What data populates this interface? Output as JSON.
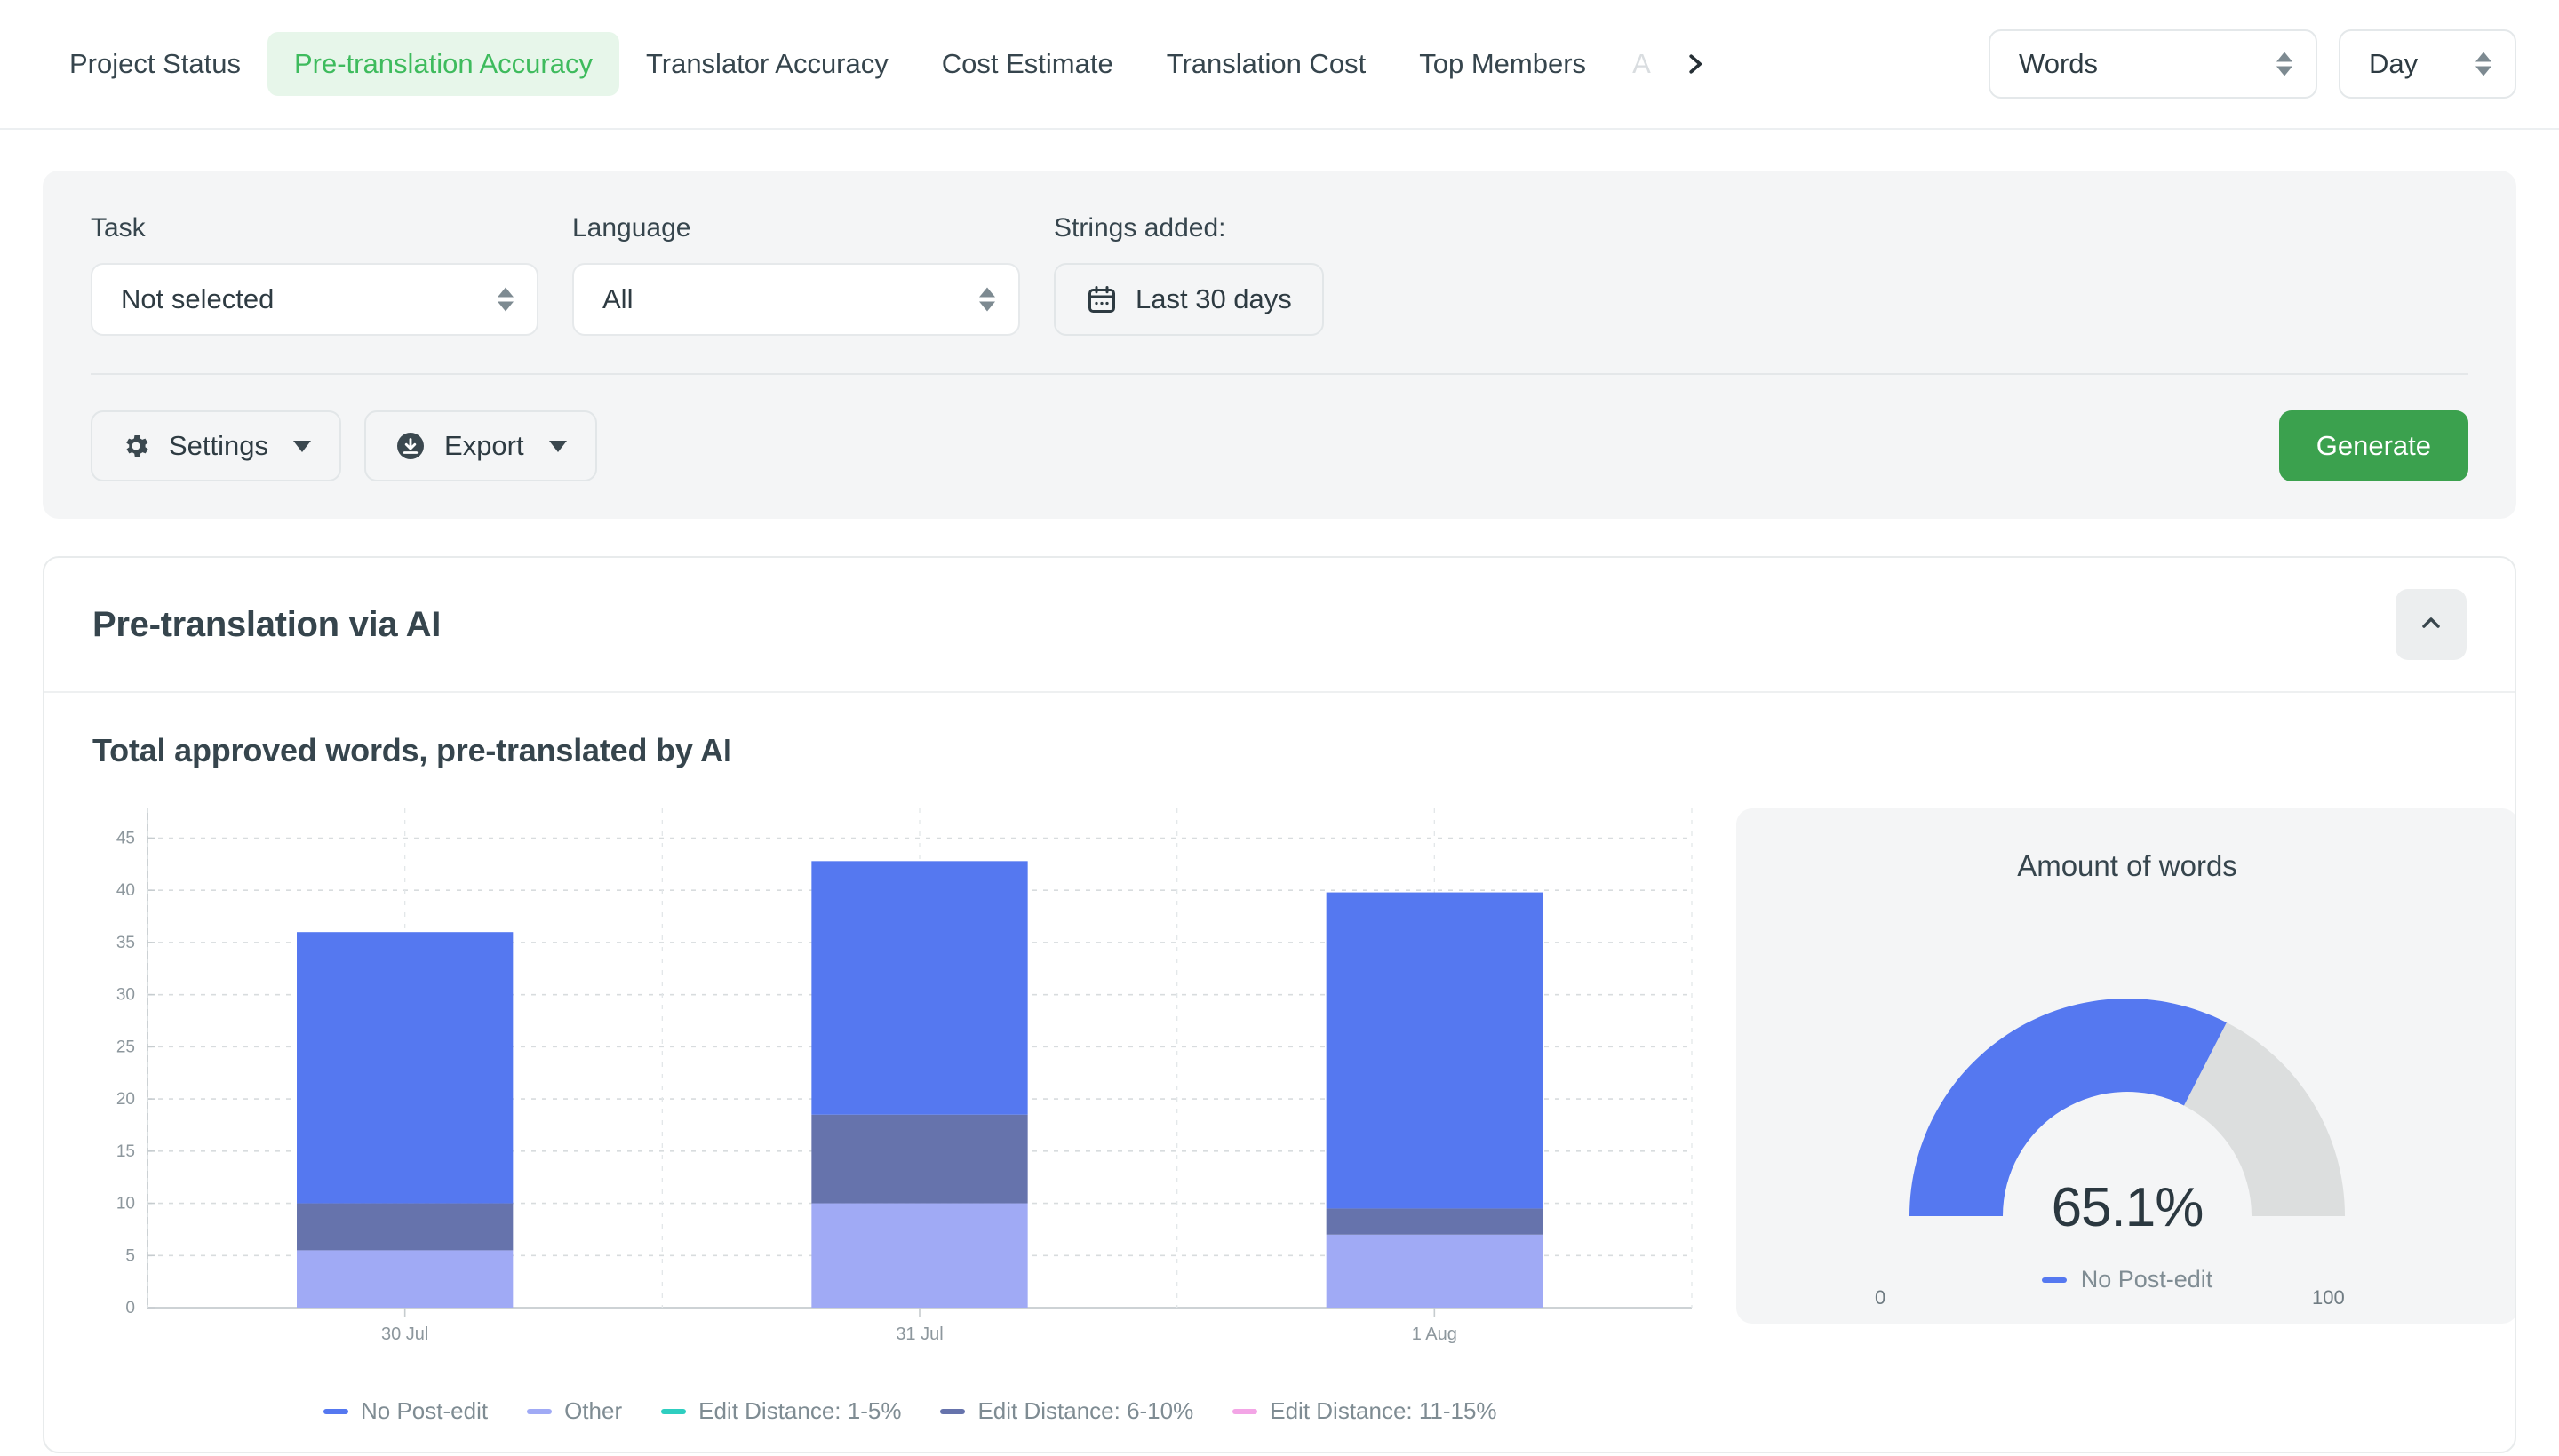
{
  "tabs": [
    {
      "label": "Project Status",
      "active": false
    },
    {
      "label": "Pre-translation Accuracy",
      "active": true
    },
    {
      "label": "Translator Accuracy",
      "active": false
    },
    {
      "label": "Cost Estimate",
      "active": false
    },
    {
      "label": "Translation Cost",
      "active": false
    },
    {
      "label": "Top Members",
      "active": false
    },
    {
      "label": "A",
      "active": false,
      "clipped": true
    }
  ],
  "tab_next_icon": "chevron-right-icon",
  "top_selects": [
    {
      "name": "unit-select",
      "value": "Words"
    },
    {
      "name": "period-select",
      "value": "Day"
    }
  ],
  "filters": {
    "task": {
      "label": "Task",
      "value": "Not selected"
    },
    "language": {
      "label": "Language",
      "value": "All"
    },
    "strings_added": {
      "label": "Strings added:",
      "value": "Last 30 days",
      "icon": "calendar-icon"
    }
  },
  "toolbar": {
    "settings_label": "Settings",
    "settings_icon": "gear-icon",
    "export_label": "Export",
    "export_icon": "download-circle-icon",
    "generate_label": "Generate"
  },
  "card": {
    "title": "Pre-translation via AI",
    "collapse_icon": "chevron-up-icon",
    "chart_title": "Total approved words, pre-translated by AI"
  },
  "colors": {
    "no_post_edit": "#5578F0",
    "other": "#A0AAF5",
    "ed_1_5": "#2ECEC0",
    "ed_6_10": "#6673AC",
    "ed_11_15": "#F3A5E6",
    "gauge_track": "#DCDEDE",
    "accent_green": "#3ba14e",
    "tab_active_text": "#3ebb5d",
    "tab_active_bg": "#e7f6ea"
  },
  "chart_data": [
    {
      "type": "bar",
      "subtype": "stacked",
      "title": "Total approved words, pre-translated by AI",
      "xlabel": "",
      "ylabel": "",
      "categories": [
        "30 Jul",
        "31 Jul",
        "1 Aug"
      ],
      "ylim": [
        0,
        47
      ],
      "yticks": [
        0,
        5,
        10,
        15,
        20,
        25,
        30,
        35,
        40,
        45
      ],
      "grid": true,
      "legend_position": "bottom",
      "series": [
        {
          "name": "Other",
          "color": "#A0AAF5",
          "values": [
            5.5,
            10.0,
            7.0
          ]
        },
        {
          "name": "Edit Distance: 6-10%",
          "color": "#6673AC",
          "values": [
            4.5,
            8.5,
            2.5
          ]
        },
        {
          "name": "No Post-edit",
          "color": "#5578F0",
          "values": [
            26.0,
            24.3,
            30.3
          ]
        },
        {
          "name": "Edit Distance: 1-5%",
          "color": "#2ECEC0",
          "values": [
            0,
            0,
            0
          ]
        },
        {
          "name": "Edit Distance: 11-15%",
          "color": "#F3A5E6",
          "values": [
            0,
            0,
            0
          ]
        }
      ],
      "totals": [
        36.0,
        42.8,
        39.8
      ],
      "legend": [
        "No Post-edit",
        "Other",
        "Edit Distance: 1-5%",
        "Edit Distance: 6-10%",
        "Edit Distance: 11-15%"
      ]
    },
    {
      "type": "gauge",
      "title": "Amount of words",
      "value": 65.1,
      "value_label": "65.1%",
      "min": 0,
      "max": 100,
      "min_label": "0",
      "max_label": "100",
      "fill_color": "#5578F0",
      "track_color": "#DCDEDE",
      "legend": [
        "No Post-edit"
      ]
    }
  ]
}
